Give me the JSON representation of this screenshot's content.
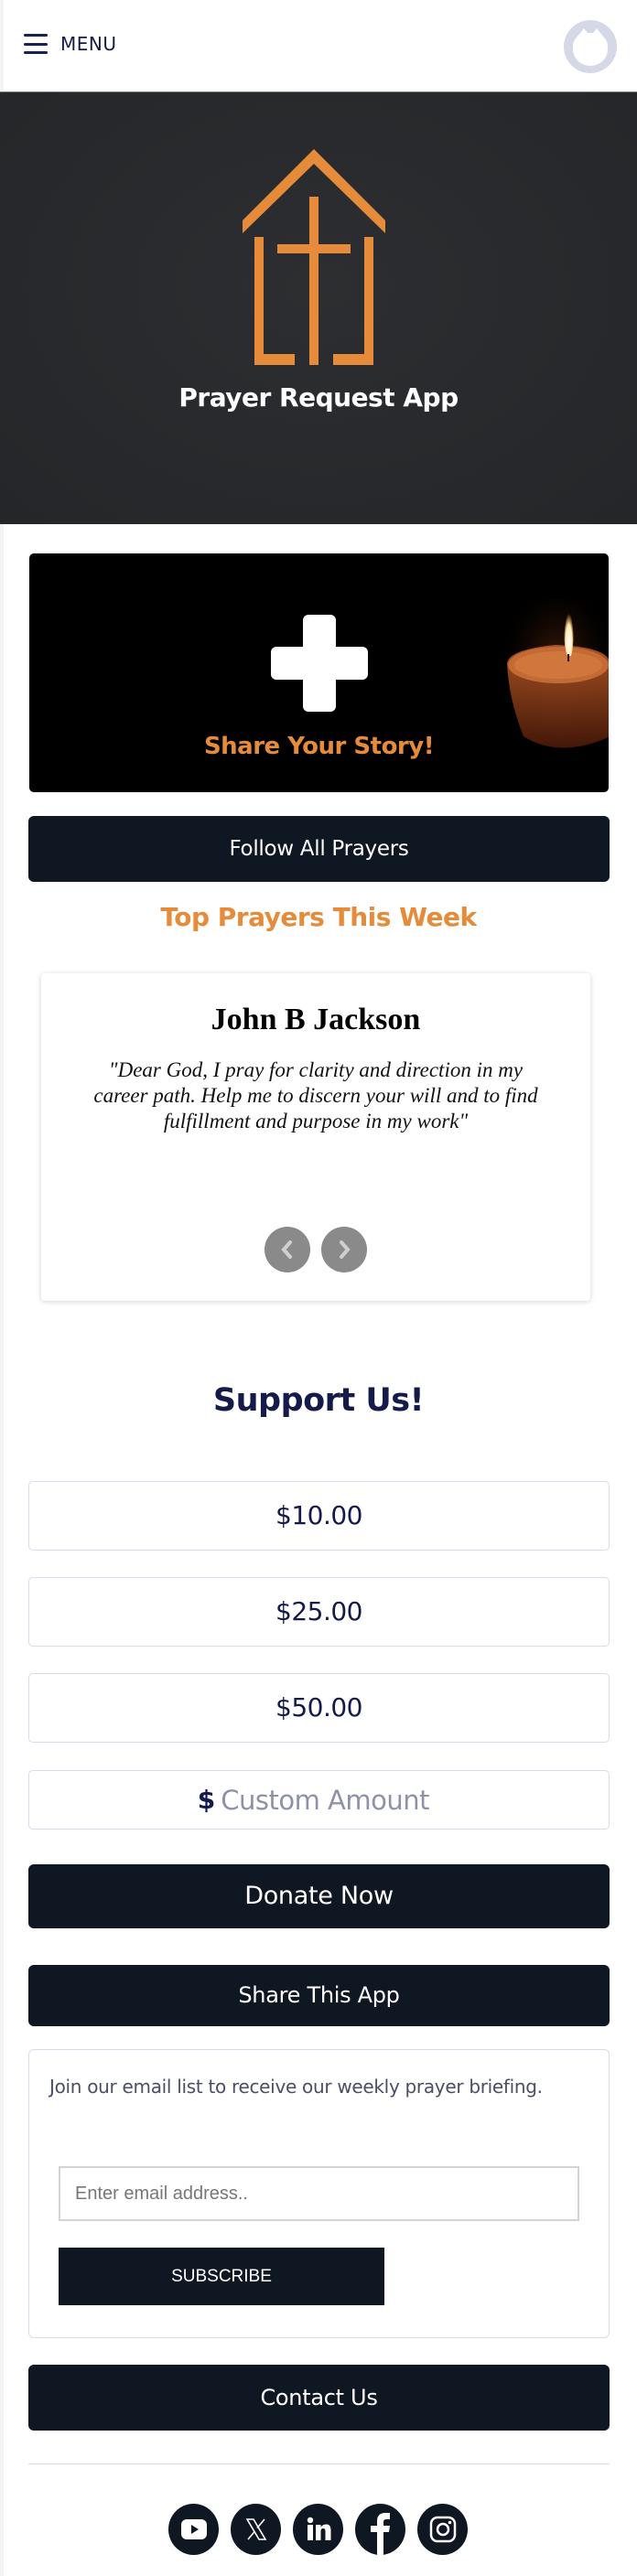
{
  "header": {
    "menu_label": "MENU",
    "menu_icon": "hamburger-icon",
    "avatar_icon": "user-avatar-icon"
  },
  "hero": {
    "title": "Prayer Request App",
    "logo_icon": "church-cross-icon",
    "colors": {
      "background": "#2a2c2f",
      "logo": "#e58b3a"
    }
  },
  "share_card": {
    "label": "Share Your Story!",
    "icon": "plus-icon",
    "image": "candle-image"
  },
  "follow_button": {
    "label": "Follow All Prayers"
  },
  "top_prayers": {
    "heading": "Top Prayers This Week",
    "current": {
      "name": "John B Jackson",
      "text": "\"Dear God, I pray for clarity and direction in my career path. Help me to discern your will and to find fulfillment and purpose in my work\""
    },
    "prev_icon": "chevron-left-icon",
    "next_icon": "chevron-right-icon"
  },
  "support": {
    "heading": "Support Us!",
    "amounts": [
      "$10.00",
      "$25.00",
      "$50.00"
    ],
    "custom_prefix": "$",
    "custom_placeholder": "Custom Amount",
    "donate_label": "Donate Now"
  },
  "share_app": {
    "label": "Share This App"
  },
  "newsletter": {
    "description": "Join our email list to receive our weekly prayer briefing.",
    "email_placeholder": "Enter email address..",
    "subscribe_label": "SUBSCRIBE"
  },
  "contact": {
    "label": "Contact Us"
  },
  "socials": [
    {
      "name": "youtube",
      "icon": "youtube-icon"
    },
    {
      "name": "x",
      "icon": "x-icon"
    },
    {
      "name": "linkedin",
      "icon": "linkedin-icon"
    },
    {
      "name": "facebook",
      "icon": "facebook-icon"
    },
    {
      "name": "instagram",
      "icon": "instagram-icon"
    }
  ],
  "colors": {
    "accent": "#e58b3a",
    "navy": "#141a4a",
    "button_dark": "#0f1722",
    "border": "#d8dbea"
  }
}
